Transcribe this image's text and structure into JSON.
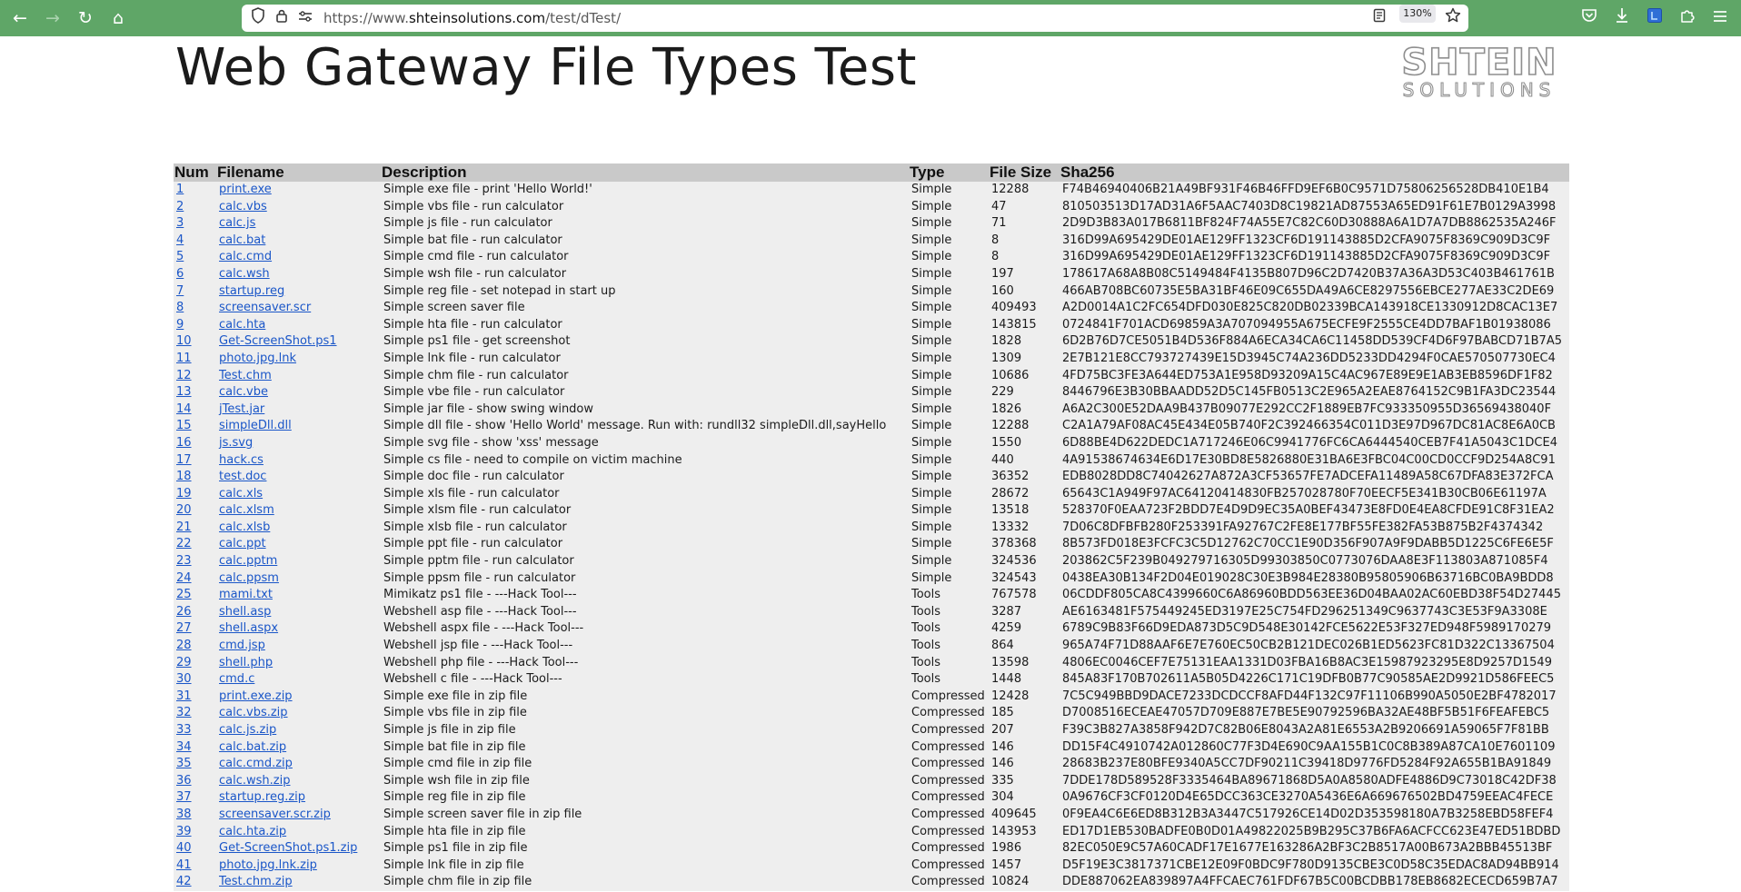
{
  "browser": {
    "url_prefix": "https://www.",
    "url_host": "shteinsolutions.com",
    "url_path": "/test/dTest/",
    "zoom": "130%"
  },
  "page": {
    "title": "Web Gateway File Types Test",
    "logo_text_top": "SHTEIN",
    "logo_text_bottom": "SOLUTIONS"
  },
  "table": {
    "headers": [
      "Num",
      "Filename",
      "Description",
      "Type",
      "File Size",
      "Sha256"
    ],
    "rows": [
      [
        "1",
        "print.exe",
        "Simple exe file - print 'Hello World!'",
        "Simple",
        "12288",
        "F74B46940406B21A49BF931F46B46FFD9EF6B0C9571D75806256528DB410E1B4"
      ],
      [
        "2",
        "calc.vbs",
        "Simple vbs file - run calculator",
        "Simple",
        "47",
        "810503513D17AD31A6F5AAC7403D8C19821AD87553A65ED91F61E7B0129A3998"
      ],
      [
        "3",
        "calc.js",
        "Simple js file - run calculator",
        "Simple",
        "71",
        "2D9D3B83A017B6811BF824F74A55E7C82C60D30888A6A1D7A7DB8862535A246F"
      ],
      [
        "4",
        "calc.bat",
        "Simple bat file - run calculator",
        "Simple",
        "8",
        "316D99A695429DE01AE129FF1323CF6D191143885D2CFA9075F8369C909D3C9F"
      ],
      [
        "5",
        "calc.cmd",
        "Simple cmd file - run calculator",
        "Simple",
        "8",
        "316D99A695429DE01AE129FF1323CF6D191143885D2CFA9075F8369C909D3C9F"
      ],
      [
        "6",
        "calc.wsh",
        "Simple wsh file - run calculator",
        "Simple",
        "197",
        "178617A68A8B08C5149484F4135B807D96C2D7420B37A36A3D53C403B461761B"
      ],
      [
        "7",
        "startup.reg",
        "Simple reg file - set notepad in start up",
        "Simple",
        "160",
        "466AB708BC60735E5BA31BF46E09C655DA49A6CE8297556EBCE277AE33C2DE69"
      ],
      [
        "8",
        "screensaver.scr",
        "Simple screen saver file",
        "Simple",
        "409493",
        "A2D0014A1C2FC654DFD030E825C820DB02339BCA143918CE1330912D8CAC13E7"
      ],
      [
        "9",
        "calc.hta",
        "Simple hta file - run calculator",
        "Simple",
        "143815",
        "0724841F701ACD69859A3A707094955A675ECFE9F2555CE4DD7BAF1B01938086"
      ],
      [
        "10",
        "Get-ScreenShot.ps1",
        "Simple ps1 file - get screenshot",
        "Simple",
        "1828",
        "6D2B76D7CE5051B4D536F884A6ECA34CA6C11458DD539CF4D6F97BABCD71B7A5"
      ],
      [
        "11",
        "photo.jpg.lnk",
        "Simple lnk file - run calculator",
        "Simple",
        "1309",
        "2E7B121E8CC793727439E15D3945C74A236DD5233DD4294F0CAE570507730EC4"
      ],
      [
        "12",
        "Test.chm",
        "Simple chm file - run calculator",
        "Simple",
        "10686",
        "4FD75BC3FE3A644ED753A1E958D93209A15C4AC967E89E9E1AB3EB8596DF1F82"
      ],
      [
        "13",
        "calc.vbe",
        "Simple vbe file - run calculator",
        "Simple",
        "229",
        "8446796E3B30BBAADD52D5C145FB0513C2E965A2EAE8764152C9B1FA3DC23544"
      ],
      [
        "14",
        "jTest.jar",
        "Simple jar file - show swing window",
        "Simple",
        "1826",
        "A6A2C300E52DAA9B437B09077E292CC2F1889EB7FC933350955D36569438040F"
      ],
      [
        "15",
        "simpleDll.dll",
        "Simple dll file - show 'Hello World' message. Run with: rundll32 simpleDll.dll,sayHello",
        "Simple",
        "12288",
        "C2A1A79AF08AC45E434E05B740F2C392466354C011D3E97D967DC81AC8E6A0CB"
      ],
      [
        "16",
        "js.svg",
        "Simple svg file - show 'xss' message",
        "Simple",
        "1550",
        "6D88BE4D622DEDC1A717246E06C9941776FC6CA6444540CEB7F41A5043C1DCE4"
      ],
      [
        "17",
        "hack.cs",
        "Simple cs file - need to compile on victim machine",
        "Simple",
        "440",
        "4A91538674634E6D17E30BD8E5826880E31BA6E3FBC04C00CD0CCF9D254A8C91"
      ],
      [
        "18",
        "test.doc",
        "Simple doc file - run calculator",
        "Simple",
        "36352",
        "EDB8028DD8C74042627A872A3CF53657FE7ADCEFA11489A58C67DFA83E372FCA"
      ],
      [
        "19",
        "calc.xls",
        "Simple xls file - run calculator",
        "Simple",
        "28672",
        "65643C1A949F97AC64120414830FB257028780F70EECF5E341B30CB06E61197A"
      ],
      [
        "20",
        "calc.xlsm",
        "Simple xlsm file - run calculator",
        "Simple",
        "13518",
        "528370F0EAA723F2BDD7E4D9D9EC35A0BEF43473E8FD0E4EA8CFDE91C8F31EA2"
      ],
      [
        "21",
        "calc.xlsb",
        "Simple xlsb file - run calculator",
        "Simple",
        "13332",
        "7D06C8DFBFB280F253391FA92767C2FE8E177BF55FE382FA53B875B2F4374342"
      ],
      [
        "22",
        "calc.ppt",
        "Simple ppt file - run calculator",
        "Simple",
        "378368",
        "8B573FD018E3FCFC3C5D12762C70CC1E90D356F907A9F9DABB5D1225C6FE6E5F"
      ],
      [
        "23",
        "calc.pptm",
        "Simple pptm file - run calculator",
        "Simple",
        "324536",
        "203862C5F239B049279716305D99303850C0773076DAA8E3F113803A871085F4"
      ],
      [
        "24",
        "calc.ppsm",
        "Simple ppsm file - run calculator",
        "Simple",
        "324543",
        "0438EA30B134F2D04E019028C30E3B984E28380B95805906B63716BC0BA9BDD8"
      ],
      [
        "25",
        "mami.txt",
        "Mimikatz ps1 file - ---Hack Tool---",
        "Tools",
        "767578",
        "06CDDF805CA8C4399660C6A86960BDD563EE36D04BAA02AC60EBD38F54D27445"
      ],
      [
        "26",
        "shell.asp",
        "Webshell asp file - ---Hack Tool---",
        "Tools",
        "3287",
        "AE6163481F575449245ED3197E25C754FD296251349C9637743C3E53F9A3308E"
      ],
      [
        "27",
        "shell.aspx",
        "Webshell aspx file - ---Hack Tool---",
        "Tools",
        "4259",
        "6789C9B83F66D9EDA873D5C9D548E30142FCE5622E53F327ED948F5989170279"
      ],
      [
        "28",
        "cmd.jsp",
        "Webshell jsp file - ---Hack Tool---",
        "Tools",
        "864",
        "965A74F71D88AAF6E7E760EC50CB2B121DEC026B1ED5623FC81D322C13367504"
      ],
      [
        "29",
        "shell.php",
        "Webshell php file - ---Hack Tool---",
        "Tools",
        "13598",
        "4806EC0046CEF7E75131EAA1331D03FBA16B8AC3E15987923295E8D9257D1549"
      ],
      [
        "30",
        "cmd.c",
        "Webshell c file - ---Hack Tool---",
        "Tools",
        "1448",
        "845A83F170B702611A5B05D4226C171C19DFB0B77C90585AE2D9921D586FEEC5"
      ],
      [
        "31",
        "print.exe.zip",
        "Simple exe file in zip file",
        "Compressed",
        "12428",
        "7C5C949BBD9DACE7233DCDCCF8AFD44F132C97F11106B990A5050E2BF4782017"
      ],
      [
        "32",
        "calc.vbs.zip",
        "Simple vbs file in zip file",
        "Compressed",
        "185",
        "D7008516ECEAE47057D709E887E7BE5E90792596BA32AE48BF5B51F6FEAFEBC5"
      ],
      [
        "33",
        "calc.js.zip",
        "Simple js file in zip file",
        "Compressed",
        "207",
        "F39C3B827A3858F942D7C82B06E8043A2A81E6553A2B9206691A59065F7F81BB"
      ],
      [
        "34",
        "calc.bat.zip",
        "Simple bat file in zip file",
        "Compressed",
        "146",
        "DD15F4C4910742A012860C77F3D4E690C9AA155B1C0C8B389A87CA10E7601109"
      ],
      [
        "35",
        "calc.cmd.zip",
        "Simple cmd file in zip file",
        "Compressed",
        "146",
        "28683B237E80BFE9340A5CC7DF90211C39418D9776FD5284F92A655B1BA91849"
      ],
      [
        "36",
        "calc.wsh.zip",
        "Simple wsh file in zip file",
        "Compressed",
        "335",
        "7DDE178D589528F3335464BA89671868D5A0A8580ADFE4886D9C73018C42DF38"
      ],
      [
        "37",
        "startup.reg.zip",
        "Simple reg file in zip file",
        "Compressed",
        "304",
        "0A9676CF3CF0120D4E65DCC363CE3270A5436E6A669676502BD4759EEAC4FECE"
      ],
      [
        "38",
        "screensaver.scr.zip",
        "Simple screen saver file in zip file",
        "Compressed",
        "409645",
        "0F9EA4C6E6ED8B312B3A3447C517926CE14D02D353598180A7B3258EBD58FEF4"
      ],
      [
        "39",
        "calc.hta.zip",
        "Simple hta file in zip file",
        "Compressed",
        "143953",
        "ED17D1EB530BADFE0B0D01A49822025B9B295C37B6FA6ACFCC623E47ED51BDBD"
      ],
      [
        "40",
        "Get-ScreenShot.ps1.zip",
        "Simple ps1 file in zip file",
        "Compressed",
        "1986",
        "82EC050E9C57A60CADF17E1677E163286A2BF3C2B8517A00B673A2BBB45513BF"
      ],
      [
        "41",
        "photo.jpg.lnk.zip",
        "Simple lnk file in zip file",
        "Compressed",
        "1457",
        "D5F19E3C3817371CBE12E09F0BDC9F780D9135CBE3C0D58C35EDAC8AD94BB914"
      ],
      [
        "42",
        "Test.chm.zip",
        "Simple chm file in zip file",
        "Compressed",
        "10824",
        "DDE887062EA839897A4FFCAEC761FDF67B5C00BCDBB178EB8682ECECD659B7A7"
      ]
    ]
  }
}
